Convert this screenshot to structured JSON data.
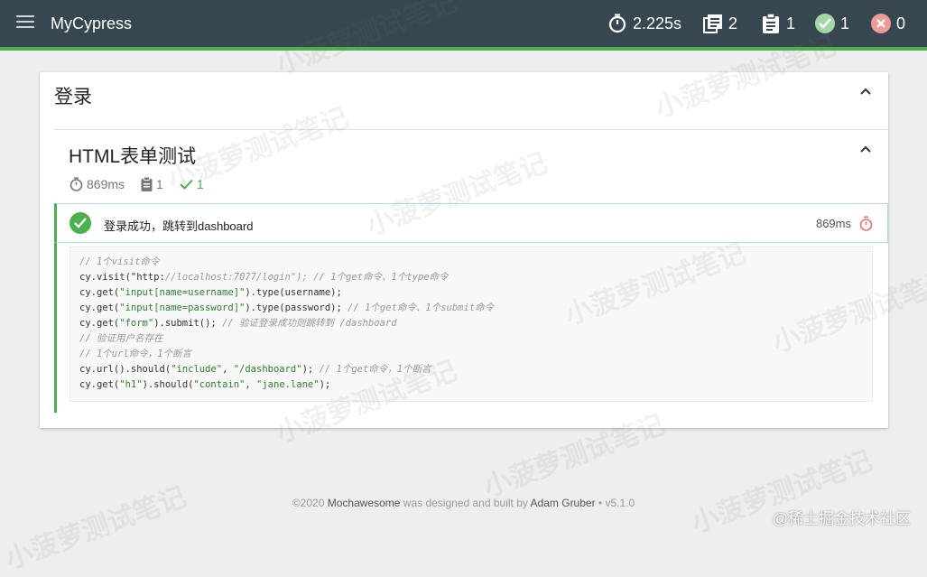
{
  "navbar": {
    "title": "MyCypress",
    "duration": "2.225s",
    "suites": "2",
    "tests": "1",
    "passes": "1",
    "failures": "0",
    "accent_color": "#4caf50",
    "bar_color": "#37474f"
  },
  "suite": {
    "title": "登录",
    "sub": {
      "title": "HTML表单测试",
      "duration": "869ms",
      "tests": "1",
      "passes": "1",
      "test": {
        "title": "登录成功，跳转到dashboard",
        "duration": "869ms"
      }
    }
  },
  "code_lines": [
    "// 1个visit命令",
    "cy.visit(\"http://localhost:7077/login\"); // 1个get命令、1个type命令",
    "cy.get(\"input[name=username]\").type(username);",
    "cy.get(\"input[name=password]\").type(password); // 1个get命令、1个submit命令",
    "cy.get(\"form\").submit(); // 验证登录成功则跳转到 /dashboard",
    "// 验证用户名存在",
    "// 1个url命令，1个断言",
    "cy.url().should(\"include\", \"/dashboard\"); // 1个get命令，1个断言",
    "cy.get(\"h1\").should(\"contain\", \"jane.lane\");"
  ],
  "footer": {
    "prefix": "©2020",
    "product": "Mochawesome",
    "middle": "was designed and built by",
    "author": "Adam Gruber",
    "version": "• v5.1.0"
  },
  "watermark_text": "小菠萝测试笔记",
  "site_mark": "@稀土掘金技术社区"
}
